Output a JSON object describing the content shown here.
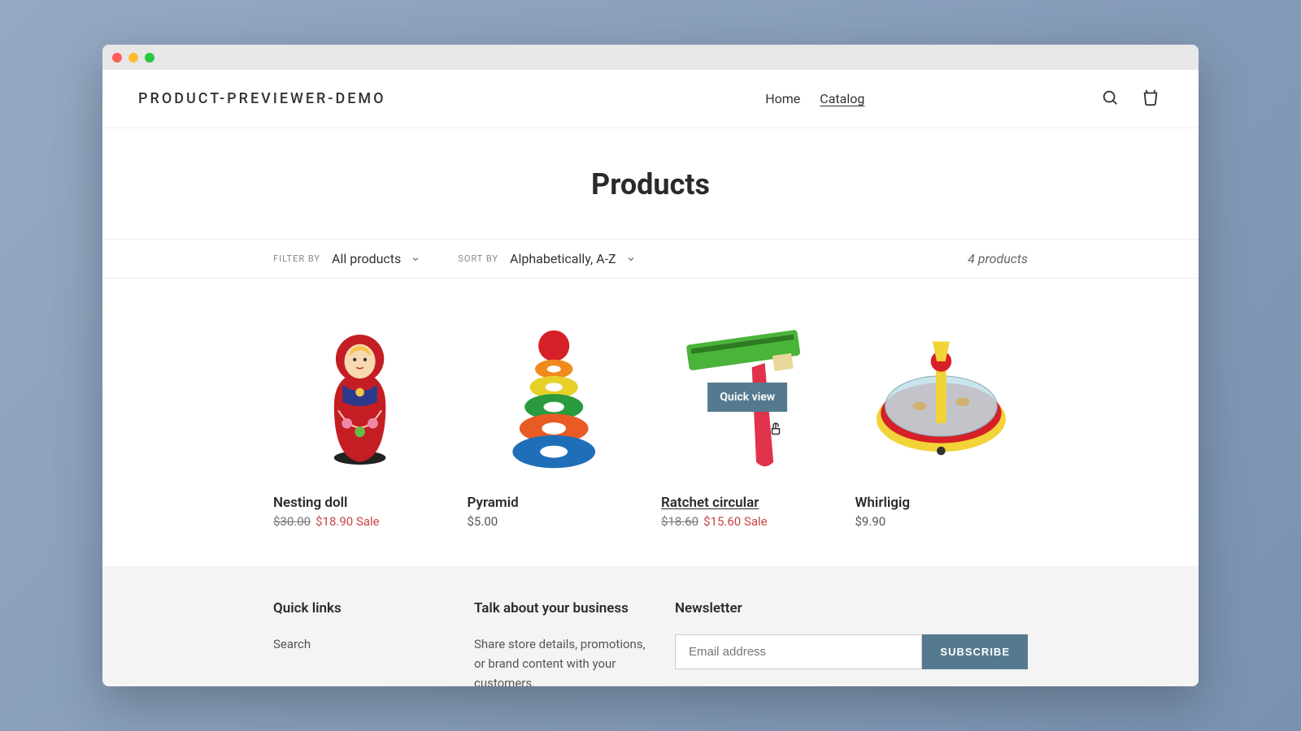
{
  "site": {
    "title": "PRODUCT-PREVIEWER-DEMO"
  },
  "nav": {
    "home": "Home",
    "catalog": "Catalog"
  },
  "page": {
    "title": "Products"
  },
  "filters": {
    "filter_label": "FILTER BY",
    "filter_value": "All products",
    "sort_label": "SORT BY",
    "sort_value": "Alphabetically, A-Z",
    "count": "4 products"
  },
  "quick_view": "Quick view",
  "products": [
    {
      "name": "Nesting doll",
      "old_price": "$30.00",
      "price": "$18.90",
      "sale": "Sale"
    },
    {
      "name": "Pyramid",
      "price": "$5.00"
    },
    {
      "name": "Ratchet circular",
      "old_price": "$18.60",
      "price": "$15.60",
      "sale": "Sale",
      "hovered": true
    },
    {
      "name": "Whirligig",
      "price": "$9.90"
    }
  ],
  "footer": {
    "quick_links": {
      "title": "Quick links",
      "search": "Search"
    },
    "about": {
      "title": "Talk about your business",
      "text": "Share store details, promotions, or brand content with your customers."
    },
    "newsletter": {
      "title": "Newsletter",
      "placeholder": "Email address",
      "button": "SUBSCRIBE"
    }
  }
}
